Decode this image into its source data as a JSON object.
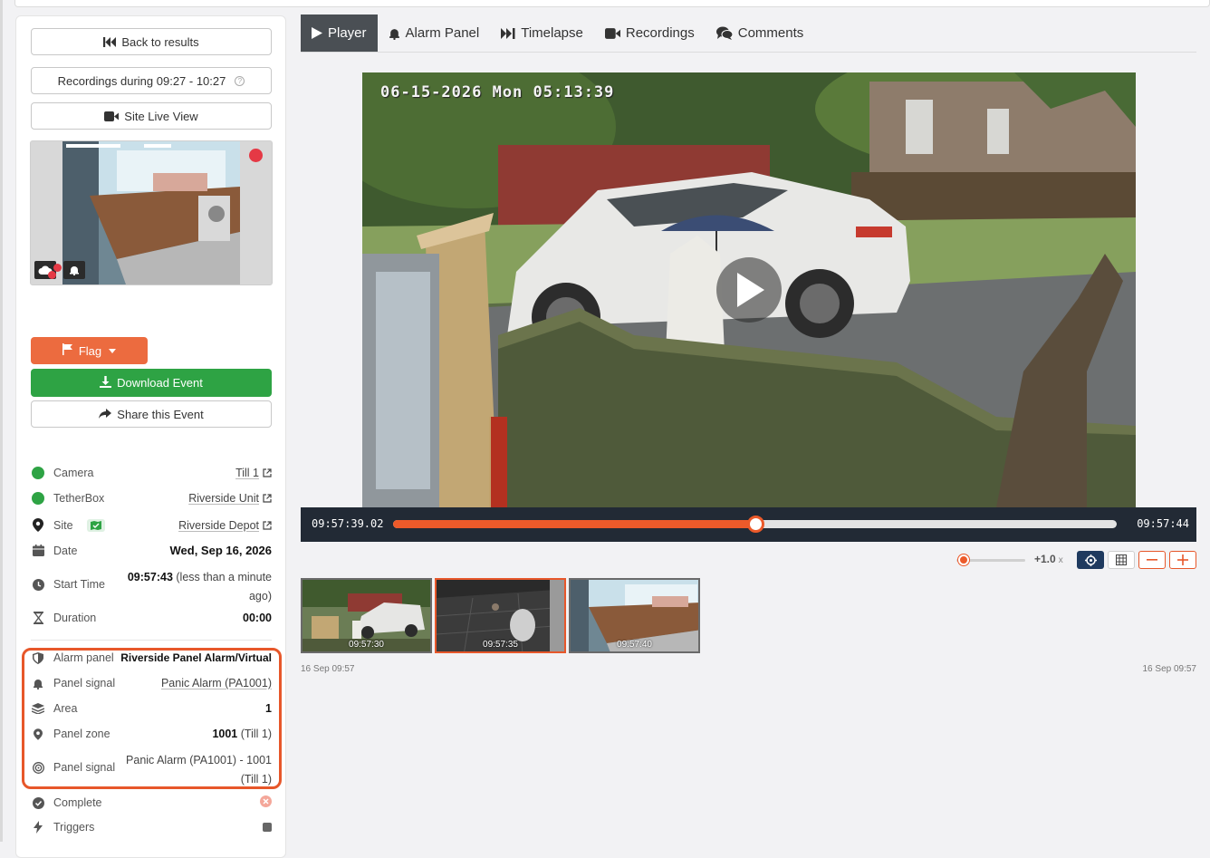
{
  "sidebar": {
    "back_label": "Back to results",
    "recordings_label": "Recordings during 09:27 - 10:27",
    "live_view_label": "Site Live View",
    "flag_label": "Flag",
    "download_label": "Download Event",
    "share_label": "Share this Event",
    "info": {
      "camera": {
        "label": "Camera",
        "value": "Till 1"
      },
      "tetherbox": {
        "label": "TetherBox",
        "value": "Riverside Unit"
      },
      "site": {
        "label": "Site",
        "value": "Riverside Depot"
      },
      "date": {
        "label": "Date",
        "value": "Wed, Sep 16, 2026"
      },
      "start_time": {
        "label": "Start Time",
        "time": "09:57:43",
        "relative": "(less than a minute",
        "relative2": "ago)"
      },
      "duration": {
        "label": "Duration",
        "value": "00:00"
      }
    },
    "panel": {
      "alarm_panel": {
        "label": "Alarm panel",
        "value": "Riverside Panel Alarm/Virtual"
      },
      "panel_signal": {
        "label": "Panel signal",
        "value": "Panic Alarm (PA1001)"
      },
      "area": {
        "label": "Area",
        "value": "1"
      },
      "panel_zone": {
        "label": "Panel zone",
        "value": "1001",
        "suffix": "(Till 1)"
      },
      "panel_signal2": {
        "label": "Panel signal",
        "value_line1": "Panic Alarm (PA1001) - 1001",
        "value_line2": "(Till 1)"
      }
    },
    "complete": {
      "label": "Complete"
    },
    "triggers": {
      "label": "Triggers"
    }
  },
  "tabs": [
    {
      "label": "Player",
      "active": true
    },
    {
      "label": "Alarm Panel"
    },
    {
      "label": "Timelapse"
    },
    {
      "label": "Recordings"
    },
    {
      "label": "Comments"
    }
  ],
  "video": {
    "osd_timestamp": "06-15-2026 Mon 05:13:39"
  },
  "player": {
    "current_time": "09:57:39.02",
    "end_time": "09:57:44",
    "progress": 0.5,
    "speed_label": "+1.0",
    "speed_unit": "x"
  },
  "timeline": {
    "thumbnails": [
      {
        "time": "09:57:30",
        "selected": false
      },
      {
        "time": "09:57:35",
        "selected": true
      },
      {
        "time": "09:57:40",
        "selected": false
      }
    ],
    "start_label": "16 Sep 09:57",
    "end_label": "16 Sep 09:57"
  },
  "colors": {
    "accent": "#ec6b3f",
    "success": "#2ea344",
    "dark": "#222a35",
    "highlight": "#e7572a"
  }
}
